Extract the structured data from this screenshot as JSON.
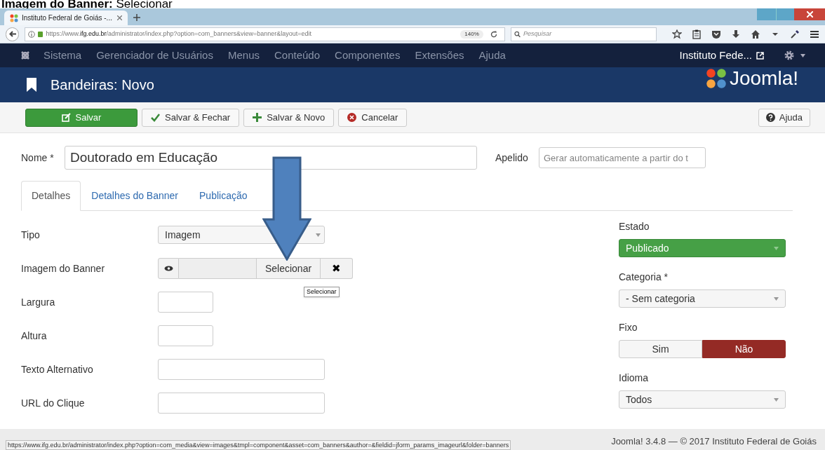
{
  "caption": "**Imagem do Banner:** Selecionar",
  "browser": {
    "tab_title": "Instituto Federal de Goiás -...",
    "url_host_prefix": "https://www.",
    "url_host": "ifg.edu.br",
    "url_path": "/administrator/index.php?option=com_banners&view=banner&layout=edit",
    "zoom": "140%",
    "search_placeholder": "Pesquisar"
  },
  "nav": {
    "items": [
      "Sistema",
      "Gerenciador de Usuários",
      "Menus",
      "Conteúdo",
      "Componentes",
      "Extensões",
      "Ajuda"
    ],
    "site_link": "Instituto Fede..."
  },
  "header": {
    "title": "Bandeiras: Novo",
    "logo": "Joomla!"
  },
  "toolbar": {
    "buttons": [
      {
        "label": "Salvar",
        "kind": "primary"
      },
      {
        "label": "Salvar & Fechar",
        "kind": "default"
      },
      {
        "label": "Salvar & Novo",
        "kind": "default"
      },
      {
        "label": "Cancelar",
        "kind": "default"
      }
    ],
    "help": "Ajuda"
  },
  "name_field": {
    "label": "Nome *",
    "value": "Doutorado em Educação"
  },
  "alias_field": {
    "label": "Apelido",
    "placeholder": "Gerar automaticamente a partir do t"
  },
  "tabs": [
    {
      "label": "Detalhes",
      "selected": true
    },
    {
      "label": "Detalhes do Banner",
      "selected": false
    },
    {
      "label": "Publicação",
      "selected": false
    }
  ],
  "fields": [
    {
      "label": "Tipo",
      "kind": "select",
      "value": "Imagem"
    },
    {
      "label": "Imagem do Banner",
      "kind": "media",
      "button": "Selecionar",
      "clear": "✖"
    },
    {
      "label": "Largura",
      "kind": "small"
    },
    {
      "label": "Altura",
      "kind": "small"
    },
    {
      "label": "Texto Alternativo",
      "kind": "text"
    },
    {
      "label": "URL do Clique",
      "kind": "text"
    }
  ],
  "tooltip": "Selecionar",
  "sidebar": [
    {
      "label": "Estado",
      "kind": "status",
      "value": "Publicado"
    },
    {
      "label": "Categoria *",
      "kind": "select",
      "value": "- Sem categoria"
    },
    {
      "label": "Fixo",
      "kind": "toggle",
      "options": [
        {
          "label": "Sim",
          "selected": false
        },
        {
          "label": "Não",
          "selected": true
        }
      ]
    },
    {
      "label": "Idioma",
      "kind": "select",
      "value": "Todos"
    }
  ],
  "footer": "Joomla! 3.4.8 — © 2017 Instituto Federal de Goiás",
  "status_url": "https://www.ifg.edu.br/administrator/index.php?option=com_media&view=images&tmpl=component&asset=com_banners&author=&fieldid=jform_params_imageurl&folder=banners"
}
